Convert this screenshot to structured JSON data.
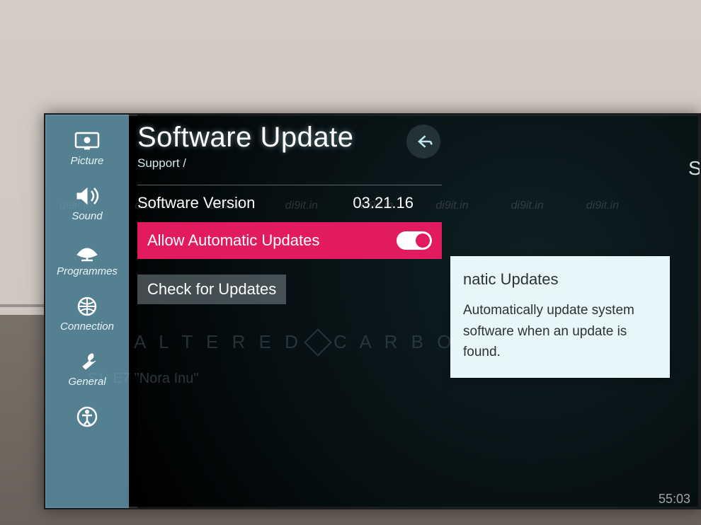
{
  "sidebar": {
    "items": [
      {
        "label": "Picture"
      },
      {
        "label": "Sound"
      },
      {
        "label": "Programmes"
      },
      {
        "label": "Connection"
      },
      {
        "label": "General"
      }
    ]
  },
  "panel": {
    "title": "Software Update",
    "breadcrumb": "Support /",
    "version_label": "Software Version",
    "version_value": "03.21.16",
    "auto_label": "Allow Automatic Updates",
    "auto_value": true,
    "check_label": "Check for Updates"
  },
  "tooltip": {
    "title": "natic Updates",
    "body": "Automatically update system software when an update is found."
  },
  "background": {
    "show_title_a": "A L T E R E D",
    "show_title_b": "C A R B O N",
    "episode_line": "S1: E7 \"Nora Inu\"",
    "right_cut": "S"
  },
  "watermark": "di9it.in",
  "clock": "55:03",
  "colors": {
    "accent": "#e21a5f",
    "sidebar": "rgba(113,171,195,.78)"
  }
}
